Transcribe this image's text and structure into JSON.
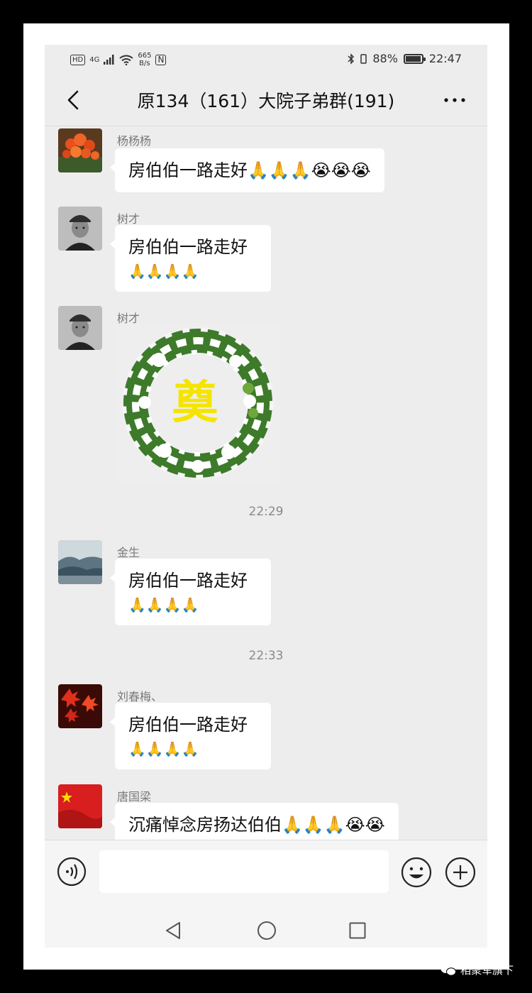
{
  "status_bar": {
    "hd": "HD",
    "network": "4G",
    "speed_value": "665",
    "speed_unit": "B/s",
    "nfc": "N",
    "battery": "88%",
    "battery_level": 0.88,
    "time": "22:47"
  },
  "header": {
    "title": "原134（161）大院子弟群(191)"
  },
  "messages": [
    {
      "sender": "杨杨杨",
      "text": "房伯伯一路走好🙏🙏🙏😭😭😭"
    },
    {
      "sender": "树才",
      "text_line1": "房伯伯一路走好",
      "text_line2": "🙏🙏🙏🙏"
    },
    {
      "sender": "树才",
      "image_text": "奠"
    },
    {
      "time": "22:29"
    },
    {
      "sender": "金生",
      "text_line1": "房伯伯一路走好",
      "text_line2": "🙏🙏🙏🙏"
    },
    {
      "time": "22:33"
    },
    {
      "sender": "刘春梅、",
      "text_line1": "房伯伯一路走好",
      "text_line2": "🙏🙏🙏🙏"
    },
    {
      "sender": "唐国梁",
      "text": "沉痛悼念房扬达伯伯🙏🙏🙏😭😭"
    }
  ],
  "watermark": "相聚军旗下",
  "colors": {
    "chat_bg": "#ededed",
    "bubble": "#ffffff",
    "sender_text": "#7a7a7a",
    "time_text": "#8a8a8a",
    "wreath_char": "#f5e400"
  }
}
